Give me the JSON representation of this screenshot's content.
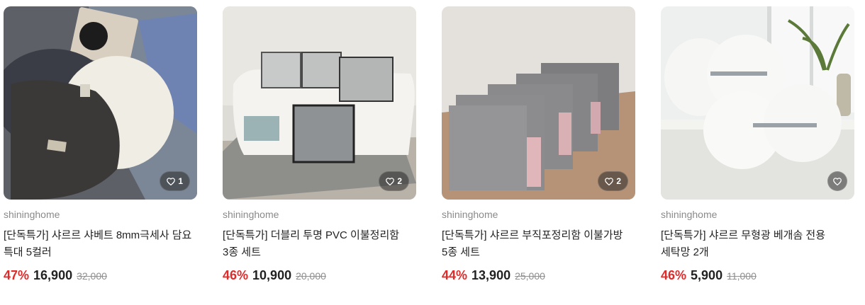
{
  "products": [
    {
      "brand": "shininghome",
      "title": "[단독특가] 샤르르 샤베트 8mm극세사 담요 특대 5컬러",
      "discount": "47%",
      "price": "16,900",
      "original_price": "32,000",
      "likes": "1",
      "like_icon": "heart-outline-icon"
    },
    {
      "brand": "shininghome",
      "title": "[단독특가] 더블리 투명 PVC 이불정리함 3종 세트",
      "discount": "46%",
      "price": "10,900",
      "original_price": "20,000",
      "likes": "2",
      "like_icon": "heart-outline-icon"
    },
    {
      "brand": "shininghome",
      "title": "[단독특가] 샤르르 부직포정리함 이불가방 5종 세트",
      "discount": "44%",
      "price": "13,900",
      "original_price": "25,000",
      "likes": "2",
      "like_icon": "heart-outline-icon"
    },
    {
      "brand": "shininghome",
      "title": "[단독특가] 샤르르 무형광 베개솜 전용 세탁망 2개",
      "discount": "46%",
      "price": "5,900",
      "original_price": "11,000",
      "likes": "",
      "like_icon": "heart-outline-icon"
    }
  ],
  "colors": {
    "discount": "#e02b2b",
    "brand_text": "#8a8a8a",
    "price_text": "#222222"
  }
}
